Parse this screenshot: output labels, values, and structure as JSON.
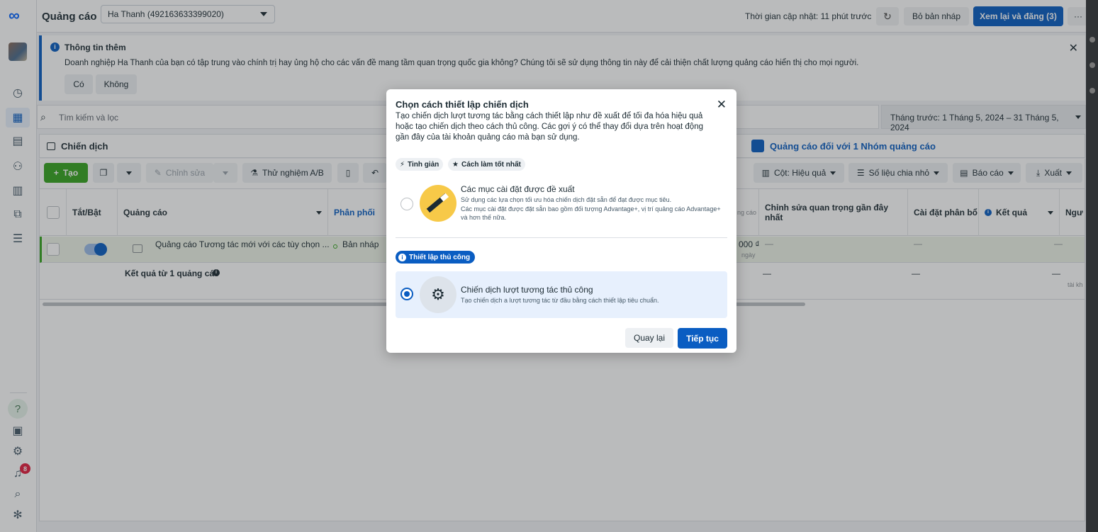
{
  "header": {
    "app_title": "Quảng cáo",
    "account_selector": "Ha Thanh (492163633399020)",
    "last_updated": "Thời gian cập nhật: 11 phút trước",
    "discard_draft": "Bỏ bản nháp",
    "review_publish": "Xem lại và đăng (3)",
    "more": "···"
  },
  "banner": {
    "title": "Thông tin thêm",
    "body": "Doanh nghiệp Ha Thanh của bạn có tập trung vào chính trị hay ủng hộ cho các vấn đề mang tầm quan trọng quốc gia không? Chúng tôi sẽ sử dụng thông tin này để cải thiện chất lượng quảng cáo hiển thị cho mọi người.",
    "yes": "Có",
    "no": "Không"
  },
  "search": {
    "placeholder": "Tìm kiếm và lọc",
    "date_range": "Tháng trước: 1 Tháng 5, 2024 – 31 Tháng 5, 2024"
  },
  "tabs": {
    "campaigns": "Chiến dịch",
    "ads_for_group": "Quảng cáo đối với 1 Nhóm quảng cáo"
  },
  "toolbar": {
    "create": "Tạo",
    "edit": "Chỉnh sửa",
    "ab_test": "Thử nghiệm A/B",
    "columns": "Cột: Hiệu quả",
    "breakdown": "Số liệu chia nhỏ",
    "reports": "Báo cáo",
    "export": "Xuất"
  },
  "table": {
    "headers": {
      "toggle": "Tắt/Bật",
      "ad": "Quảng cáo",
      "delivery": "Phân phối",
      "cost_partial": "ng cáo",
      "recent_edits": "Chỉnh sửa quan trọng gần đây nhất",
      "attribution": "Cài đặt phân bổ",
      "results": "Kết quả",
      "reach_partial": "Ngư"
    },
    "row": {
      "ad_name": "Quảng cáo Tương tác mới với các tùy chọn ...",
      "delivery": "Bản nháp",
      "budget_partial": "000 ₫",
      "budget_unit_partial": "ngày",
      "dash": "—"
    },
    "summary": {
      "label": "Kết quả từ 1 quảng cáo",
      "dash": "—",
      "account_partial": "tài kh"
    }
  },
  "modal": {
    "title": "Chọn cách thiết lập chiến dịch",
    "description": "Tạo chiến dịch lượt tương tác bằng cách thiết lập như đề xuất để tối đa hóa hiệu quả hoặc tạo chiến dịch theo cách thủ công. Các gợi ý có thể thay đổi dựa trên hoạt động gần đây của tài khoản quảng cáo mà bạn sử dụng.",
    "chip_streamlined": "Tinh giản",
    "chip_best_practice": "Cách làm tốt nhất",
    "recommended": {
      "title": "Các mục cài đặt được đề xuất",
      "line1": "Sử dụng các lựa chọn tối ưu hóa chiến dịch đặt sẵn để đạt được mục tiêu.",
      "line2": "Các mục cài đặt được đặt sẵn bao gồm đối tượng Advantage+, vị trí quảng cáo Advantage+ và hơn thế nữa."
    },
    "manual_pill": "Thiết lập thủ công",
    "manual": {
      "title": "Chiến dịch lượt tương tác thủ công",
      "desc": "Tạo chiến dịch a lượt tương tác từ đầu bằng cách thiết lập tiêu chuẩn."
    },
    "back": "Quay lại",
    "continue": "Tiếp tục"
  },
  "rail": {
    "notification_count": "8",
    "help": "?"
  }
}
